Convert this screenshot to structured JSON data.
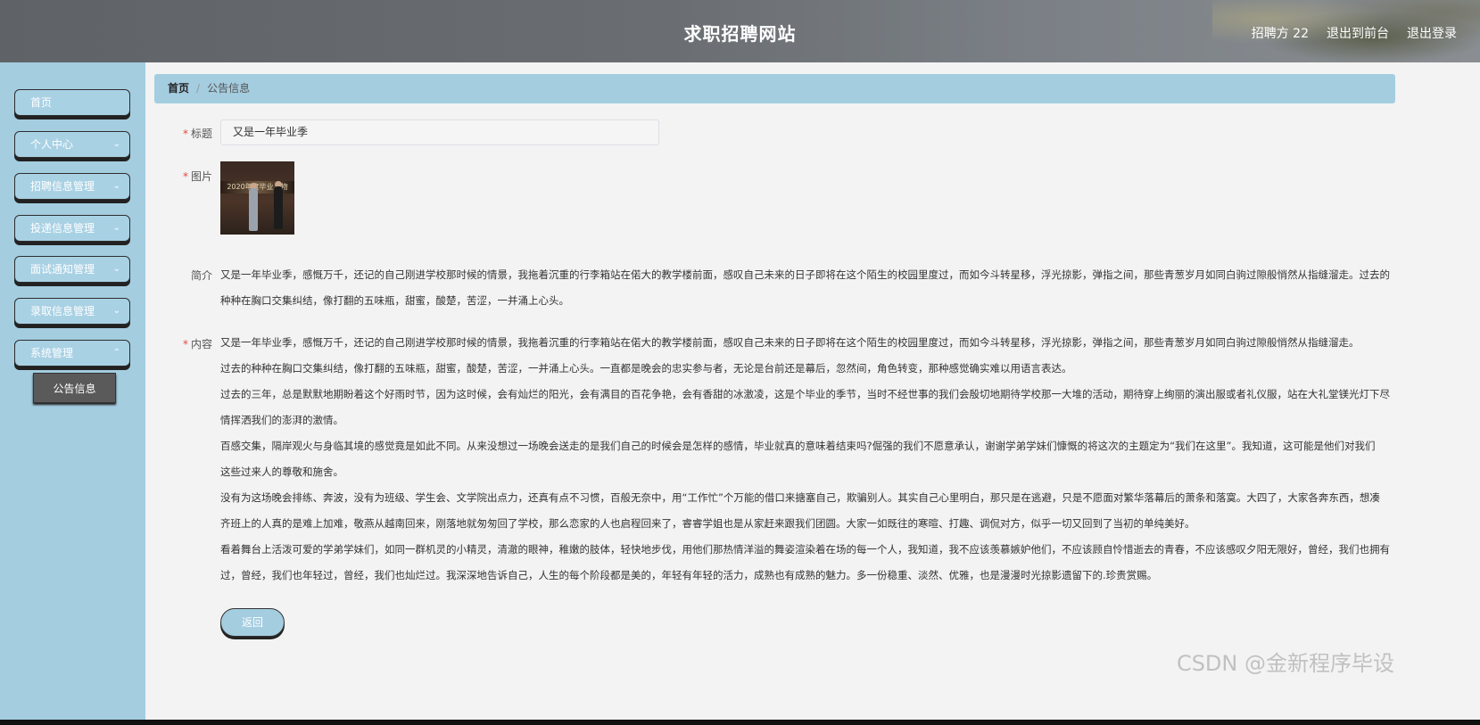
{
  "header": {
    "title": "求职招聘网站",
    "user": "招聘方 22",
    "to_front": "退出到前台",
    "logout": "退出登录"
  },
  "sidebar": {
    "items": [
      {
        "label": "首页",
        "has_arrow": false
      },
      {
        "label": "个人中心",
        "has_arrow": true
      },
      {
        "label": "招聘信息管理",
        "has_arrow": true
      },
      {
        "label": "投递信息管理",
        "has_arrow": true
      },
      {
        "label": "面试通知管理",
        "has_arrow": true
      },
      {
        "label": "录取信息管理",
        "has_arrow": true
      },
      {
        "label": "系统管理",
        "has_arrow": true
      }
    ],
    "sub_item": "公告信息"
  },
  "breadcrumb": {
    "home": "首页",
    "separator": "/",
    "current": "公告信息"
  },
  "form": {
    "title_label": "标题",
    "title_value": "又是一年毕业季",
    "image_label": "图片",
    "image_caption": "2020年度毕业人物",
    "intro_label": "简介",
    "intro_lines": [
      "又是一年毕业季，感慨万千，还记的自己刚进学校那时候的情景，我拖着沉重的行李箱站在偌大的教学楼前面，感叹自己未来的日子即将在这个陌生的校园里度过，而如今斗转星移，浮光掠影，弹指之间，那些青葱岁月如同白驹过隙般悄然从指缝溜走。过去的",
      "种种在胸口交集纠结，像打翻的五味瓶，甜蜜，酸楚，苦涩，一并涌上心头。"
    ],
    "content_label": "内容",
    "content_lines": [
      "又是一年毕业季，感慨万千，还记的自己刚进学校那时候的情景，我拖着沉重的行李箱站在偌大的教学楼前面，感叹自己未来的日子即将在这个陌生的校园里度过，而如今斗转星移，浮光掠影，弹指之间，那些青葱岁月如同白驹过隙般悄然从指缝溜走。",
      "过去的种种在胸口交集纠结，像打翻的五味瓶，甜蜜，酸楚，苦涩，一并涌上心头。一直都是晚会的忠实参与者，无论是台前还是幕后，忽然间，角色转变，那种感觉确实难以用语言表达。",
      "过去的三年，总是默默地期盼着这个好雨时节，因为这时候，会有灿烂的阳光，会有满目的百花争艳，会有香甜的冰激凌，这是个毕业的季节，当时不经世事的我们会殷切地期待学校那一大堆的活动，期待穿上绚丽的演出服或者礼仪服，站在大礼堂镁光灯下尽",
      "情挥洒我们的澎湃的激情。",
      "百感交集，隔岸观火与身临其境的感觉竟是如此不同。从来没想过一场晚会送走的是我们自己的时候会是怎样的感情，毕业就真的意味着结束吗?倔强的我们不愿意承认，谢谢学弟学妹们慷慨的将这次的主题定为“我们在这里”。我知道，这可能是他们对我们",
      "这些过来人的尊敬和施舍。",
      "没有为这场晚会排练、奔波，没有为班级、学生会、文学院出点力，还真有点不习惯，百般无奈中，用“工作忙”个万能的借口来搪塞自己，欺骗别人。其实自己心里明白，那只是在逃避，只是不愿面对繁华落幕后的萧条和落寞。大四了，大家各奔东西，想凑",
      "齐班上的人真的是难上加难，敬燕从越南回来，刚落地就匆匆回了学校，那么恋家的人也启程回来了，睿睿学姐也是从家赶来跟我们团圆。大家一如既往的寒暄、打趣、调侃对方，似乎一切又回到了当初的单纯美好。",
      "看着舞台上活泼可爱的学弟学妹们，如同一群机灵的小精灵，清澈的眼神，稚嫩的肢体，轻快地步伐，用他们那热情洋溢的舞姿渲染着在场的每一个人，我知道，我不应该羡慕嫉妒他们，不应该顾自怜惜逝去的青春，不应该感叹夕阳无限好，曾经，我们也拥有",
      "过，曾经，我们也年轻过，曾经，我们也灿烂过。我深深地告诉自己，人生的每个阶段都是美的，年轻有年轻的活力，成熟也有成熟的魅力。多一份稳重、淡然、优雅，也是漫漫时光掠影遗留下的.珍贵赏赐。"
    ],
    "back_button": "返回"
  },
  "watermark": "CSDN @金新程序毕设",
  "colors": {
    "accent": "#a4cde0",
    "header_bg": "#62666a",
    "required": "#e64a3c"
  }
}
